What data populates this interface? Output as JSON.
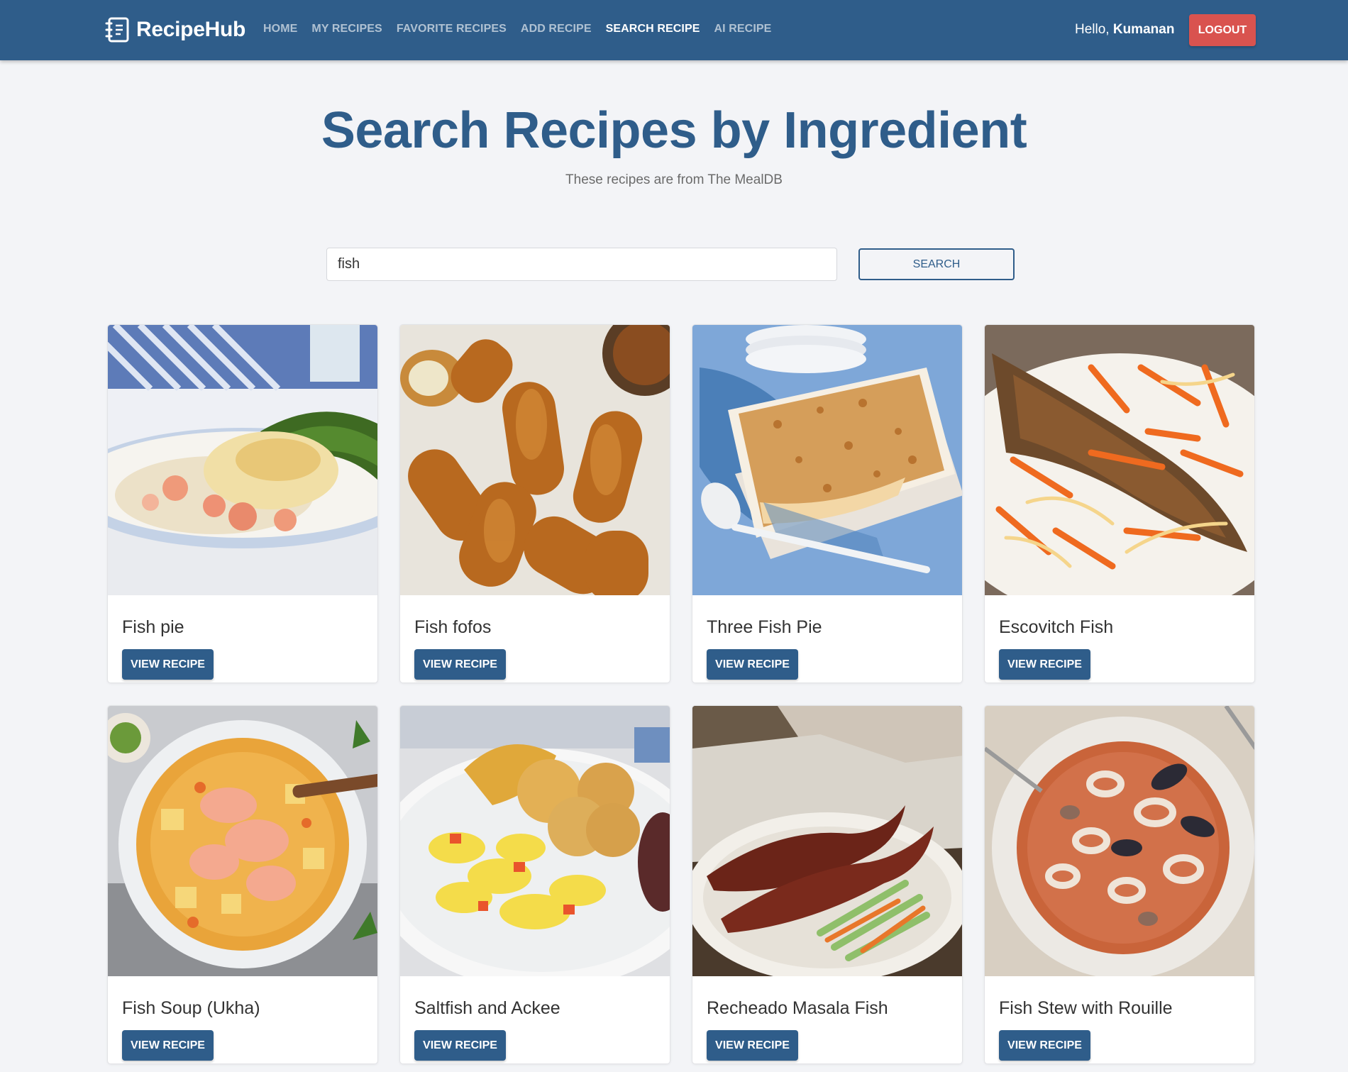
{
  "app": {
    "name": "RecipeHub",
    "accent_color": "#2f5d8a",
    "danger_color": "#d9534f",
    "logo_icon": "recipe-book-icon"
  },
  "nav": {
    "links": [
      {
        "label": "HOME",
        "active": false
      },
      {
        "label": "MY RECIPES",
        "active": false
      },
      {
        "label": "FAVORITE RECIPES",
        "active": false
      },
      {
        "label": "ADD RECIPE",
        "active": false
      },
      {
        "label": "SEARCH RECIPE",
        "active": true
      },
      {
        "label": "AI RECIPE",
        "active": false
      }
    ],
    "greeting_prefix": "Hello,",
    "username": "Kumanan",
    "logout_label": "LOGOUT"
  },
  "page": {
    "title": "Search Recipes by Ingredient",
    "subtitle": "These recipes are from The MealDB"
  },
  "search": {
    "value": "fish",
    "button_label": "SEARCH"
  },
  "recipes": [
    {
      "title": "Fish pie",
      "button_label": "VIEW RECIPE",
      "image": "fish-pie-photo"
    },
    {
      "title": "Fish fofos",
      "button_label": "VIEW RECIPE",
      "image": "fish-fofos-photo"
    },
    {
      "title": "Three Fish Pie",
      "button_label": "VIEW RECIPE",
      "image": "three-fish-pie-photo"
    },
    {
      "title": "Escovitch Fish",
      "button_label": "VIEW RECIPE",
      "image": "escovitch-fish-photo"
    },
    {
      "title": "Fish Soup (Ukha)",
      "button_label": "VIEW RECIPE",
      "image": "fish-soup-photo"
    },
    {
      "title": "Saltfish and Ackee",
      "button_label": "VIEW RECIPE",
      "image": "saltfish-ackee-photo"
    },
    {
      "title": "Recheado Masala Fish",
      "button_label": "VIEW RECIPE",
      "image": "recheado-masala-fish-photo"
    },
    {
      "title": "Fish Stew with Rouille",
      "button_label": "VIEW RECIPE",
      "image": "fish-stew-photo"
    }
  ]
}
